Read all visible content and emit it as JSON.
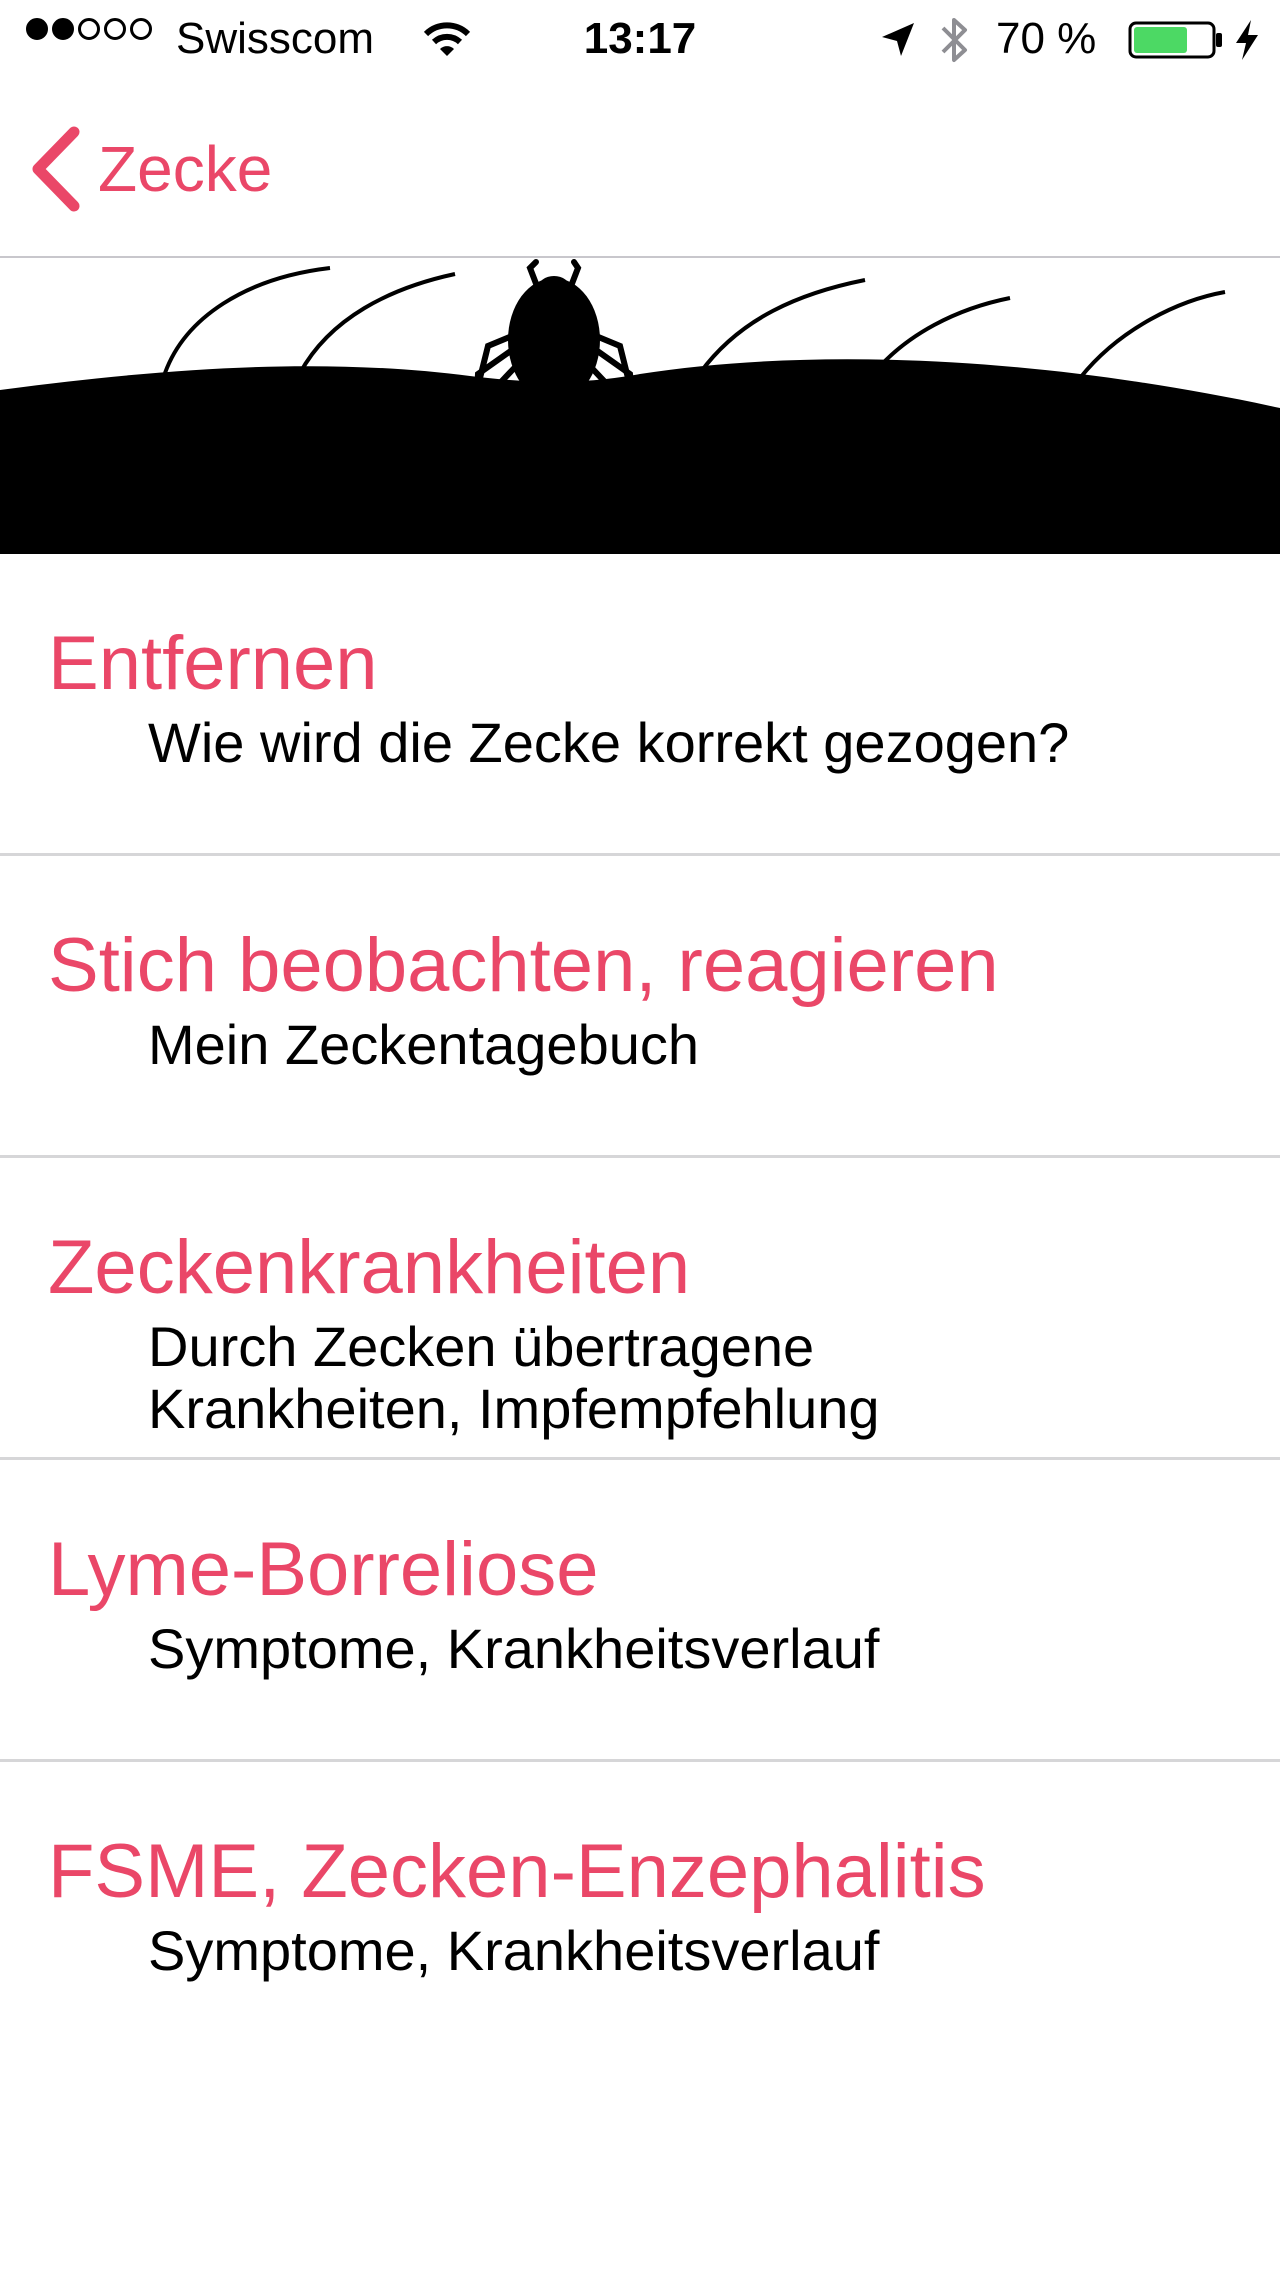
{
  "status_bar": {
    "carrier": "Swisscom",
    "time": "13:17",
    "battery_percent": "70 %",
    "battery_level": 0.7,
    "signal_strength": 2,
    "signal_total": 5
  },
  "nav": {
    "back_label": "Zecke"
  },
  "colors": {
    "accent": "#ea4768",
    "separator": "#d6d6d8",
    "battery": "#4cd964"
  },
  "menu": {
    "items": [
      {
        "title": "Entfernen",
        "subtitle": "Wie wird die Zecke korrekt gezogen?"
      },
      {
        "title": "Stich beobachten, reagieren",
        "subtitle": "Mein Zeckentagebuch"
      },
      {
        "title": "Zeckenkrankheiten",
        "subtitle": "Durch Zecken übertragene Krankheiten, Impfempfehlung"
      },
      {
        "title": "Lyme-Borreliose",
        "subtitle": "Symptome, Krankheitsverlauf"
      },
      {
        "title": "FSME, Zecken-Enzephalitis",
        "subtitle": "Symptome, Krankheitsverlauf"
      }
    ]
  }
}
